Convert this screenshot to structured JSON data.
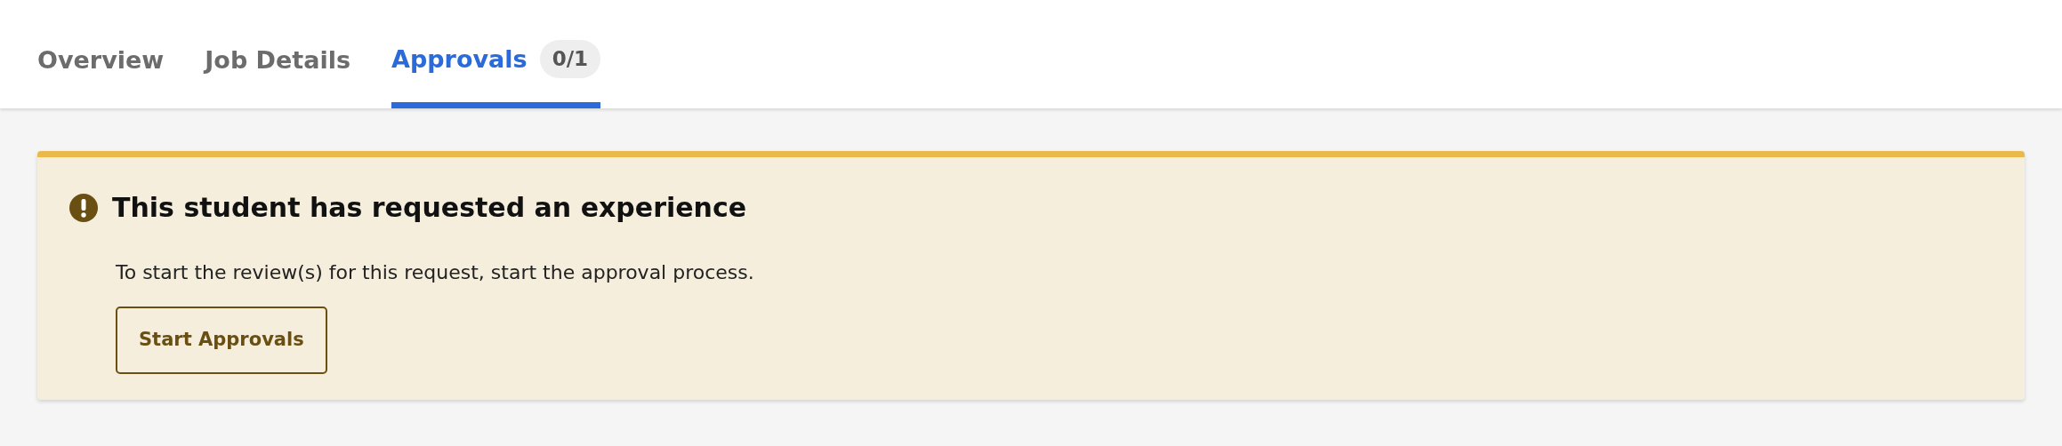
{
  "tabs": [
    {
      "label": "Overview",
      "selected": false
    },
    {
      "label": "Job Details",
      "selected": false
    },
    {
      "label": "Approvals",
      "selected": true,
      "badge": "0/1"
    }
  ],
  "alert": {
    "title": "This student has requested an experience",
    "message": "To start the review(s) for this request, start the approval process.",
    "button": "Start Approvals"
  }
}
